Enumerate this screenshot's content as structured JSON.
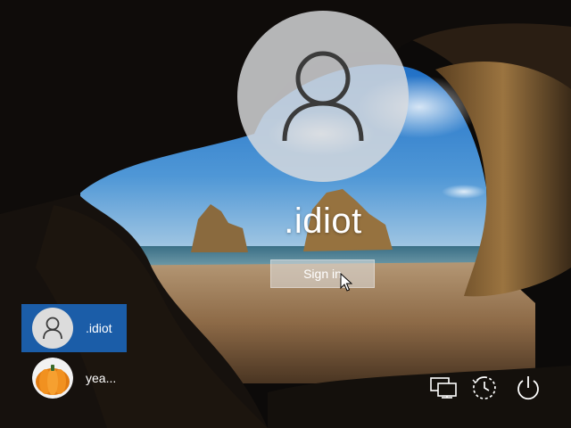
{
  "lock_screen": {
    "current_user": ".idiot",
    "sign_in_label": "Sign in"
  },
  "user_list": [
    {
      "name": ".idiot",
      "avatar": "person-icon",
      "selected": true
    },
    {
      "name": "yea...",
      "avatar": "pumpkin-avatar",
      "selected": false
    }
  ],
  "system_buttons": [
    "network-icon",
    "ease-of-access-icon",
    "power-icon"
  ],
  "colors": {
    "selected_tile": "#1b5da8",
    "avatar_circle": "#dadcde",
    "text": "#ffffff"
  }
}
